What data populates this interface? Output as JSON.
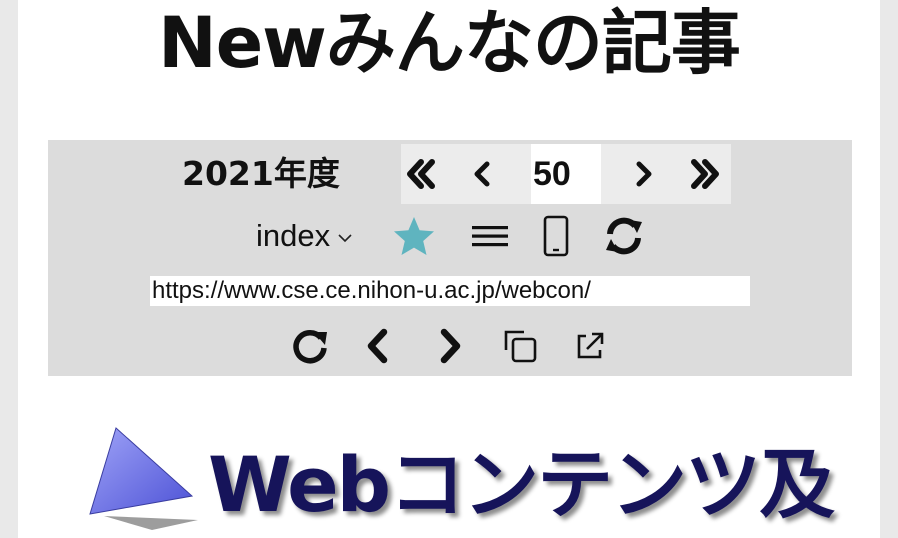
{
  "page": {
    "title": "Newみんなの記事"
  },
  "toolbar": {
    "year_label": "2021年度",
    "page_number": "50",
    "first_icon": "double-chevron-left-icon",
    "prev_icon": "chevron-left-icon",
    "next_icon": "chevron-right-icon",
    "last_icon": "double-chevron-right-icon",
    "index_label": "index",
    "star_color": "#5fb4bf",
    "address_url": "https://www.cse.ce.nihon-u.ac.jp/webcon/"
  },
  "banner": {
    "text": "Webコンテンツ及",
    "text_color": "#16145a",
    "triangle_color": "#6f74e6"
  }
}
